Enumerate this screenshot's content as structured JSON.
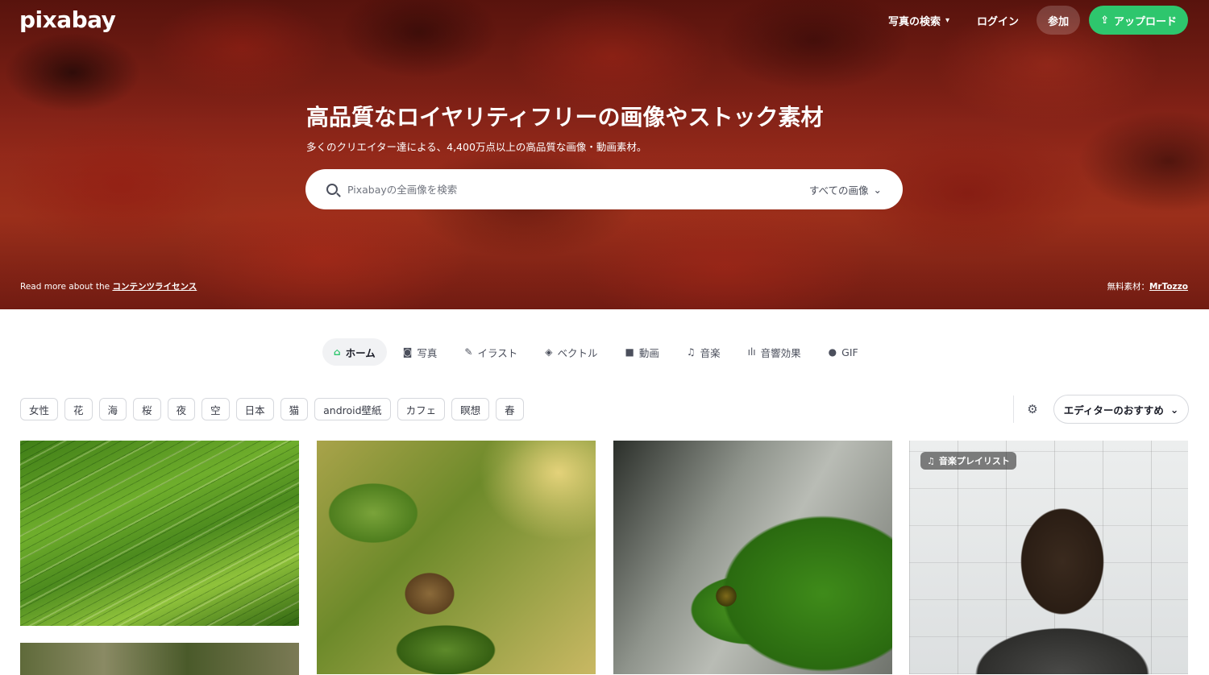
{
  "header": {
    "logo": "pixabay",
    "nav_search": "写真の検索",
    "login": "ログイン",
    "join": "参加",
    "upload": "アップロード"
  },
  "hero": {
    "title": "高品質なロイヤリティフリーの画像やストック素材",
    "subtitle": "多くのクリエイター達による、4,400万点以上の高品質な画像・動画素材。",
    "search": {
      "placeholder": "Pixabayの全画像を検索",
      "type_label": "すべての画像"
    },
    "license_prefix": "Read more about the",
    "license_link": "コンテンツライセンス",
    "credit_prefix": "無料素材：",
    "credit_author": "MrTozzo"
  },
  "tabs": [
    {
      "label": "ホーム",
      "icon": "home-icon",
      "active": true
    },
    {
      "label": "写真",
      "icon": "camera-icon"
    },
    {
      "label": "イラスト",
      "icon": "brush-icon"
    },
    {
      "label": "ベクトル",
      "icon": "vector-icon"
    },
    {
      "label": "動画",
      "icon": "video-icon"
    },
    {
      "label": "音楽",
      "icon": "music-icon"
    },
    {
      "label": "音響効果",
      "icon": "waveform-icon"
    },
    {
      "label": "GIF",
      "icon": "gif-icon"
    }
  ],
  "chips": [
    "女性",
    "花",
    "海",
    "桜",
    "夜",
    "空",
    "日本",
    "猫",
    "android壁紙",
    "カフェ",
    "瞑想",
    "春"
  ],
  "sort": {
    "label": "エディターのおすすめ"
  },
  "grid": {
    "office_badge": "音楽プレイリスト"
  },
  "colors": {
    "accent": "#2ec66d",
    "text": "#191b26"
  }
}
